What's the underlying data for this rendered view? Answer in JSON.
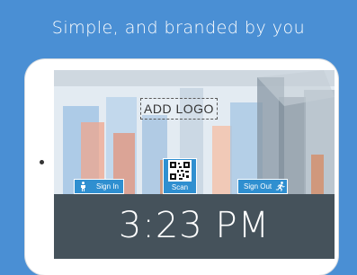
{
  "headline": "Simple, and branded by you",
  "kiosk": {
    "logo_placeholder": "ADD LOGO",
    "sign_in_label": "Sign In",
    "scan_label": "Scan",
    "sign_out_label": "Sign Out",
    "time": "3:23 PM"
  },
  "icons": {
    "sign_in": "person-standing-icon",
    "scan": "qr-code-icon",
    "sign_out": "running-person-icon"
  },
  "colors": {
    "background": "#4a8fd4",
    "button": "#2f8fd0",
    "clock_bar": "#45525b"
  }
}
